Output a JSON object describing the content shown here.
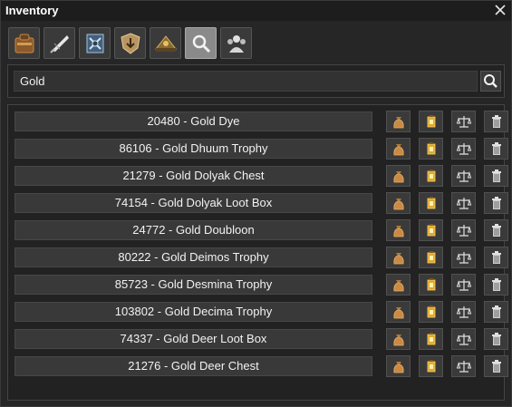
{
  "window": {
    "title": "Inventory"
  },
  "tabs": [
    {
      "icon": "bag-icon",
      "active": false
    },
    {
      "icon": "quill-icon",
      "active": false
    },
    {
      "icon": "bank-vault-icon",
      "active": false
    },
    {
      "icon": "shield-arrow-icon",
      "active": false
    },
    {
      "icon": "treasure-pile-icon",
      "active": false
    },
    {
      "icon": "magnifier-icon",
      "active": true
    },
    {
      "icon": "guild-icon",
      "active": false
    }
  ],
  "search": {
    "value": "Gold",
    "placeholder": ""
  },
  "items": [
    {
      "label": "20480 - Gold Dye"
    },
    {
      "label": "86106 - Gold Dhuum Trophy"
    },
    {
      "label": "21279 - Gold Dolyak Chest"
    },
    {
      "label": "74154 - Gold Dolyak Loot Box"
    },
    {
      "label": "24772 - Gold Doubloon"
    },
    {
      "label": "80222 - Gold Deimos Trophy"
    },
    {
      "label": "85723 - Gold Desmina Trophy"
    },
    {
      "label": "103802 - Gold Decima Trophy"
    },
    {
      "label": "74337 - Gold Deer Loot Box"
    },
    {
      "label": "21276 - Gold Deer Chest"
    }
  ],
  "row_actions": [
    "money-bag-icon",
    "lantern-icon",
    "scales-icon",
    "trash-icon"
  ],
  "colors": {
    "background": "#262626",
    "accent_gold": "#d9a441",
    "active_tab": "#8a8a8a"
  }
}
